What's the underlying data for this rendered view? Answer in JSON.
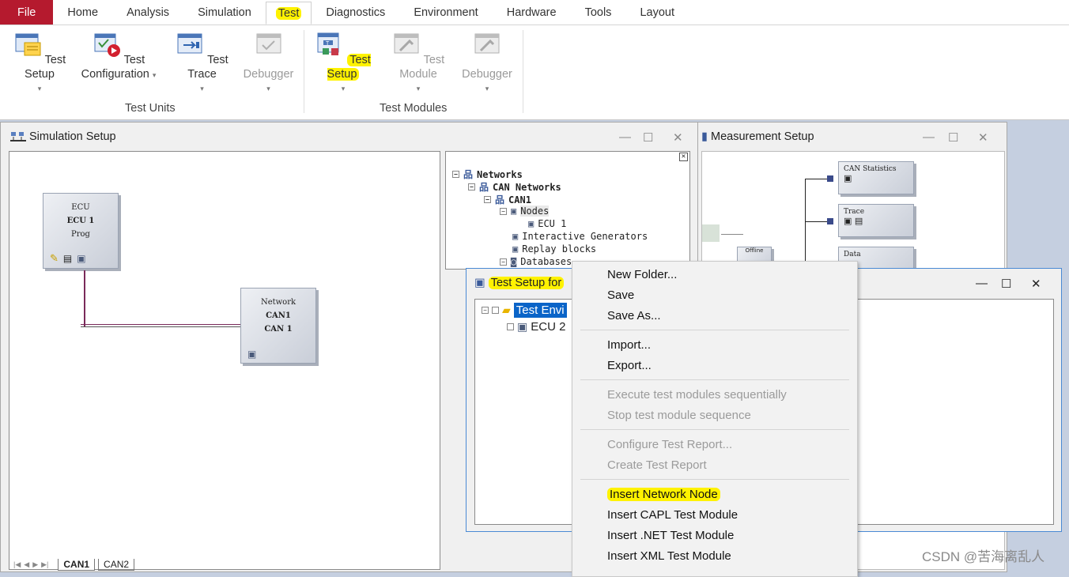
{
  "menu": {
    "tabs": [
      "File",
      "Home",
      "Analysis",
      "Simulation",
      "Test",
      "Diagnostics",
      "Environment",
      "Hardware",
      "Tools",
      "Layout"
    ],
    "active": "Test"
  },
  "ribbon": {
    "test_units": {
      "label": "Test Units",
      "buttons": [
        "Test Setup",
        "Test",
        "Configuration",
        "Test Trace",
        "Debugger"
      ]
    },
    "test_modules": {
      "label": "Test Modules",
      "buttons": [
        "Test Setup",
        "Test Module",
        "Debugger"
      ]
    }
  },
  "simulation_setup": {
    "title": "Simulation Setup",
    "ecu_block": [
      "ECU",
      "ECU 1",
      "Prog"
    ],
    "network_block": [
      "Network",
      "CAN1",
      "CAN 1"
    ],
    "bottom_tabs": [
      "CAN1",
      "CAN2"
    ],
    "tree": {
      "networks": "Networks",
      "can_networks": "CAN Networks",
      "can1": "CAN1",
      "nodes": "Nodes",
      "ecu1": "ECU 1",
      "interactive_generators": "Interactive Generators",
      "replay_blocks": "Replay blocks",
      "databases": "Databases"
    }
  },
  "measurement_setup": {
    "title": "Measurement Setup",
    "blocks": [
      "CAN Statistics",
      "Trace",
      "Data"
    ],
    "offline": "Offline"
  },
  "test_setup_window": {
    "title": "Test Setup for",
    "items": [
      "Test Envi",
      "ECU 2"
    ]
  },
  "context_menu": {
    "groups": [
      [
        "New Folder...",
        "Save",
        "Save As..."
      ],
      [
        "Import...",
        "Export..."
      ],
      [
        "Execute test modules sequentially",
        "Stop test module sequence"
      ],
      [
        "Configure Test Report...",
        "Create Test Report"
      ],
      [
        "Insert Network Node",
        "Insert CAPL Test Module",
        "Insert .NET Test Module",
        "Insert XML Test Module"
      ]
    ]
  },
  "watermark": "CSDN @苦海离乱人",
  "colors": {
    "file_tab": "#b51a2e",
    "highlight": "#fff200",
    "selection": "#0a64c8",
    "desktop": "#c5cfe0"
  }
}
